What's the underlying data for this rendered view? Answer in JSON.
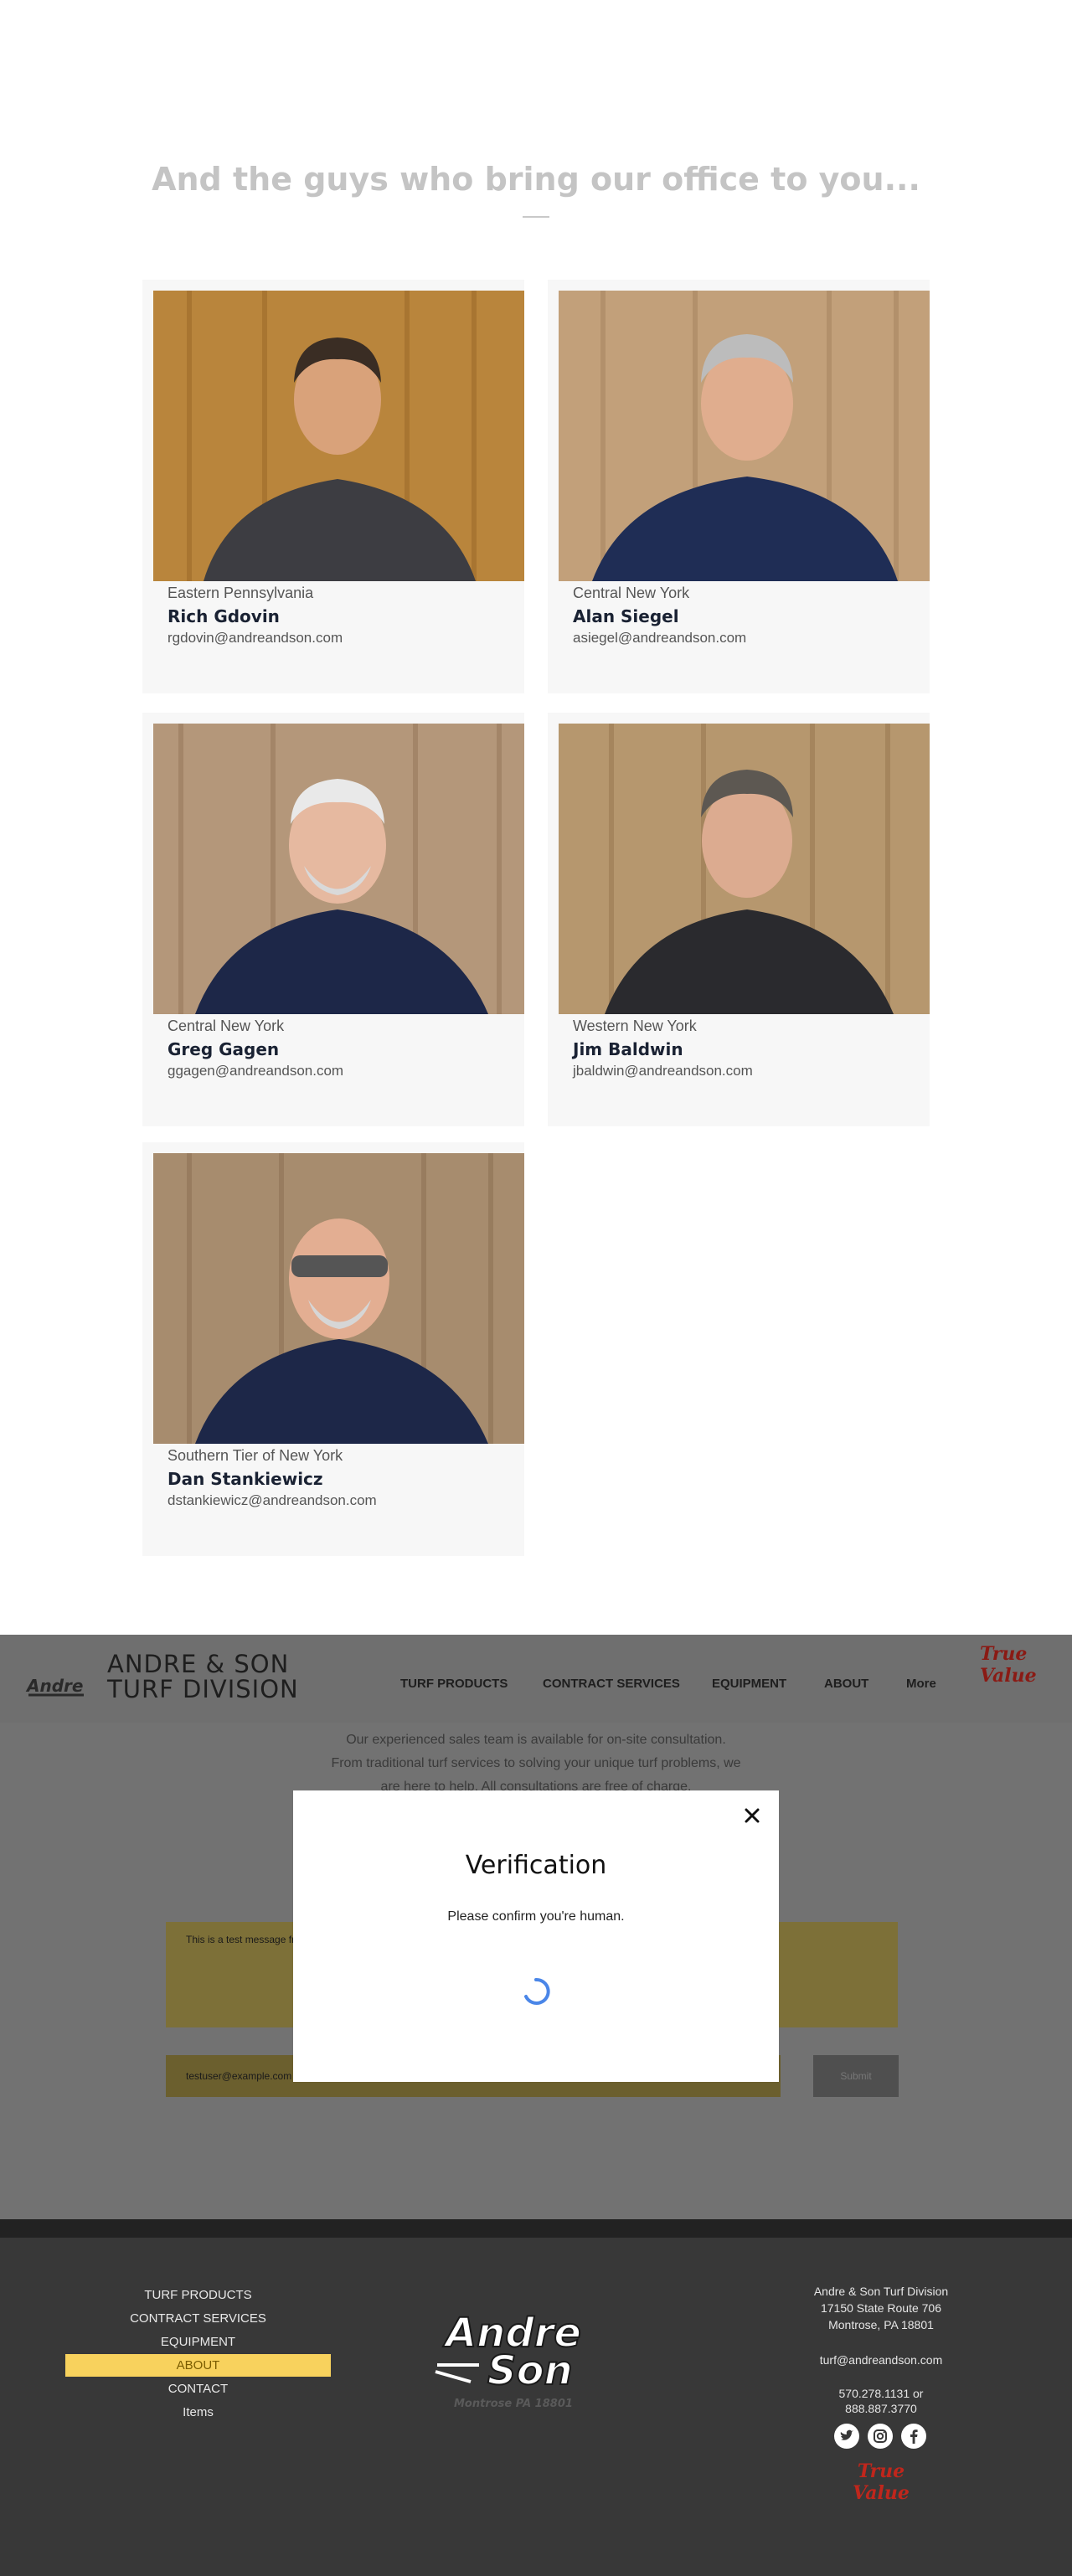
{
  "team": {
    "title": "And the guys who bring our office to you...",
    "members": [
      {
        "region": "Eastern Pennsylvania",
        "name": "Rich Gdovin",
        "email": "rgdovin@andreandson.com"
      },
      {
        "region": "Central New York",
        "name": "Alan Siegel",
        "email": "asiegel@andreandson.com"
      },
      {
        "region": "Central New York",
        "name": "Greg Gagen",
        "email": "ggagen@andreandson.com"
      },
      {
        "region": "Western New York",
        "name": "Jim Baldwin",
        "email": "jbaldwin@andreandson.com"
      },
      {
        "region": "Southern Tier of New York",
        "name": "Dan Stankiewicz",
        "email": "dstankiewicz@andreandson.com"
      }
    ]
  },
  "header": {
    "brand_line1": "ANDRE & SON",
    "brand_line2": "TURF DIVISION",
    "nav": [
      "TURF PRODUCTS",
      "CONTRACT SERVICES",
      "EQUIPMENT",
      "ABOUT",
      "More"
    ],
    "partner_logo": "True Value"
  },
  "contact": {
    "intro_line1": "Our experienced sales team is available for on-site consultation.",
    "intro_line2": "From traditional turf services to solving your unique turf problems, we",
    "intro_line3": "are here to help. All consultations are free of charge.",
    "message_value": "This is a test message fr",
    "email_value": "testuser@example.com",
    "submit_label": "Submit"
  },
  "modal": {
    "title": "Verification",
    "subtitle": "Please confirm you're human.",
    "close_icon": "close-icon",
    "spinner_color": "#4a86e8"
  },
  "footer": {
    "menu": [
      "TURF PRODUCTS",
      "CONTRACT SERVICES",
      "EQUIPMENT",
      "ABOUT",
      "CONTACT",
      "Items"
    ],
    "active_menu": "ABOUT",
    "logo_text_line1": "Andre",
    "logo_text_line2": "Son",
    "logo_tagline": "Montrose PA 18801",
    "company": "Andre & Son Turf Division",
    "street": "17150 State Route 706",
    "city": "Montrose, PA 18801",
    "email": "turf@andreandson.com",
    "phone1": "570.278.1131 or",
    "phone2": "888.887.3770",
    "social": [
      "twitter-icon",
      "instagram-icon",
      "facebook-icon"
    ],
    "partner_logo": "True Value"
  },
  "colors": {
    "accent_yellow": "#f8d25d",
    "footer_bg": "#383838",
    "overlay": "#727272",
    "true_value_red": "#c0261c"
  }
}
